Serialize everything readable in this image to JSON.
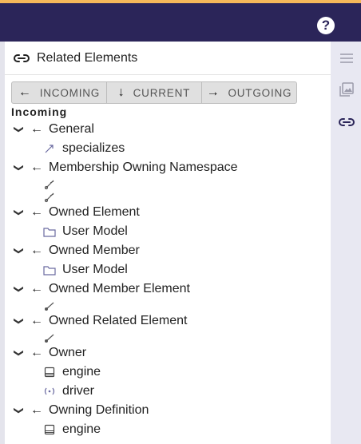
{
  "header": {
    "title": "Related Elements"
  },
  "toggle": {
    "buttons": [
      {
        "label": "INCOMING"
      },
      {
        "label": "CURRENT"
      },
      {
        "label": "OUTGOING"
      }
    ]
  },
  "section": {
    "label": "Incoming"
  },
  "tree": [
    {
      "label": "General",
      "children": [
        {
          "icon": "specialization-icon",
          "label": "specializes"
        }
      ]
    },
    {
      "label": "Membership Owning Namespace",
      "children": [
        {
          "icon": "membership-icon",
          "label": ""
        },
        {
          "icon": "membership-icon",
          "label": ""
        }
      ]
    },
    {
      "label": "Owned Element",
      "children": [
        {
          "icon": "package-icon",
          "label": "User Model"
        }
      ]
    },
    {
      "label": "Owned Member",
      "children": [
        {
          "icon": "package-icon",
          "label": "User Model"
        }
      ]
    },
    {
      "label": "Owned Member Element",
      "children": [
        {
          "icon": "relationship-icon",
          "label": ""
        }
      ]
    },
    {
      "label": "Owned Related Element",
      "children": [
        {
          "icon": "relationship-icon",
          "label": ""
        }
      ]
    },
    {
      "label": "Owner",
      "children": [
        {
          "icon": "part-definition-icon",
          "label": "engine"
        },
        {
          "icon": "port-icon",
          "label": "driver"
        }
      ]
    },
    {
      "label": "Owning Definition",
      "children": [
        {
          "icon": "part-definition-icon",
          "label": "engine"
        }
      ]
    }
  ]
}
